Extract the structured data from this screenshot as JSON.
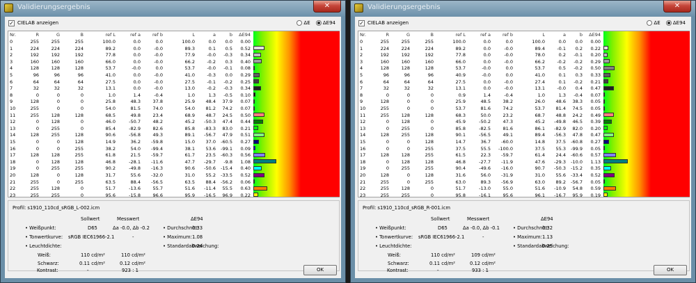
{
  "windows": [
    {
      "title": "Validierungsergebnis",
      "show_cielab_label": "CIELAB anzeigen",
      "radio_de": "ΔE",
      "radio_de94": "ΔE94",
      "headers": [
        "Nr.",
        "R",
        "G",
        "B",
        "ref L",
        "ref a",
        "ref b",
        "L",
        "a",
        "b",
        "ΔE94"
      ],
      "rows": [
        [
          "0",
          "255",
          "255",
          "255",
          "100.0",
          "0.0",
          "0.0",
          "100.0",
          "0.0",
          "0.0",
          "0.00"
        ],
        [
          "1",
          "224",
          "224",
          "224",
          "89.2",
          "0.0",
          "-0.0",
          "89.3",
          "0.1",
          "0.5",
          "0.52"
        ],
        [
          "2",
          "192",
          "192",
          "192",
          "77.8",
          "0.0",
          "-0.0",
          "77.9",
          "-0.0",
          "-0.3",
          "0.34"
        ],
        [
          "3",
          "160",
          "160",
          "160",
          "66.0",
          "0.0",
          "-0.0",
          "66.2",
          "-0.2",
          "0.3",
          "0.40"
        ],
        [
          "4",
          "128",
          "128",
          "128",
          "53.7",
          "-0.0",
          "0.0",
          "53.7",
          "-0.0",
          "-0.1",
          "0.08"
        ],
        [
          "5",
          "96",
          "96",
          "96",
          "41.0",
          "0.0",
          "-0.0",
          "41.0",
          "-0.3",
          "0.0",
          "0.29"
        ],
        [
          "6",
          "64",
          "64",
          "64",
          "27.5",
          "0.0",
          "-0.0",
          "27.5",
          "-0.1",
          "-0.2",
          "0.25"
        ],
        [
          "7",
          "32",
          "32",
          "32",
          "13.1",
          "0.0",
          "-0.0",
          "13.0",
          "-0.2",
          "-0.3",
          "0.34"
        ],
        [
          "8",
          "0",
          "0",
          "0",
          "1.0",
          "1.4",
          "-0.4",
          "1.0",
          "1.3",
          "-0.5",
          "0.10"
        ],
        [
          "9",
          "128",
          "0",
          "0",
          "25.8",
          "48.3",
          "37.8",
          "25.9",
          "48.4",
          "37.9",
          "0.07"
        ],
        [
          "10",
          "255",
          "0",
          "0",
          "54.0",
          "81.5",
          "74.0",
          "54.0",
          "81.2",
          "74.2",
          "0.07"
        ],
        [
          "11",
          "255",
          "128",
          "128",
          "68.5",
          "49.8",
          "23.4",
          "68.9",
          "48.7",
          "24.5",
          "0.50"
        ],
        [
          "12",
          "0",
          "128",
          "0",
          "46.0",
          "-50.7",
          "48.2",
          "45.2",
          "-50.3",
          "47.4",
          "0.44"
        ],
        [
          "13",
          "0",
          "255",
          "0",
          "85.4",
          "-82.9",
          "82.6",
          "85.8",
          "-83.3",
          "83.0",
          "0.21"
        ],
        [
          "14",
          "128",
          "255",
          "128",
          "90.6",
          "-56.8",
          "49.3",
          "89.1",
          "-56.7",
          "47.9",
          "0.51"
        ],
        [
          "15",
          "0",
          "0",
          "128",
          "14.9",
          "36.2",
          "-59.8",
          "15.0",
          "37.0",
          "-60.5",
          "0.27"
        ],
        [
          "16",
          "0",
          "0",
          "255",
          "38.2",
          "54.0",
          "-99.4",
          "38.1",
          "53.6",
          "-99.1",
          "0.09"
        ],
        [
          "17",
          "128",
          "128",
          "255",
          "61.8",
          "21.5",
          "-59.7",
          "61.7",
          "23.5",
          "-60.3",
          "0.56"
        ],
        [
          "18",
          "0",
          "128",
          "128",
          "46.8",
          "-28.1",
          "-11.6",
          "47.7",
          "-29.7",
          "-9.8",
          "1.08"
        ],
        [
          "19",
          "0",
          "255",
          "255",
          "90.2",
          "-49.8",
          "-16.3",
          "90.6",
          "-50.6",
          "-15.4",
          "0.40"
        ],
        [
          "20",
          "128",
          "0",
          "128",
          "31.7",
          "55.6",
          "-32.0",
          "31.0",
          "55.2",
          "-33.5",
          "0.52"
        ],
        [
          "21",
          "255",
          "0",
          "255",
          "63.5",
          "88.4",
          "-56.5",
          "63.5",
          "88.4",
          "-56.2",
          "0.06"
        ],
        [
          "22",
          "255",
          "128",
          "0",
          "51.7",
          "-13.6",
          "55.7",
          "51.6",
          "-11.4",
          "55.5",
          "0.63"
        ],
        [
          "23",
          "255",
          "255",
          "0",
          "95.6",
          "-15.8",
          "96.6",
          "95.9",
          "-16.5",
          "96.9",
          "0.22"
        ]
      ],
      "profile": "Profil:  s1910_110cd_sRGB_L-002.icm",
      "col_soll": "Sollwert",
      "col_mess": "Messwert",
      "col_de": "ΔE94",
      "weisspunkt_label": "• Weißpunkt:",
      "weisspunkt_soll": "D65",
      "weisspunkt_mess": "Δa -0.0, Δb -0.2",
      "tonwert_label": "• Tonwertkurve:",
      "tonwert_soll": "sRGB IEC61966-2.1",
      "tonwert_mess": "-",
      "leucht_label": "• Leuchtdichte:",
      "weiss_label": "Weiß:",
      "weiss_soll": "110 cd/m²",
      "weiss_mess": "110 cd/m²",
      "schwarz_label": "Schwarz:",
      "schwarz_soll": "0.11 cd/m²",
      "schwarz_mess": "0.12 cd/m²",
      "kontrast_label": "Kontrast:",
      "kontrast_soll": "-",
      "kontrast_mess": "923 : 1",
      "durch_label": "• Durchschnitt:",
      "durch_val": "0.33",
      "max_label": "• Maximum:",
      "max_val": "1.08",
      "std_label": "• Standardabweichung:",
      "std_val": "0.24",
      "ok_label": "OK"
    },
    {
      "title": "Validierungsergebnis",
      "show_cielab_label": "CIELAB anzeigen",
      "radio_de": "ΔE",
      "radio_de94": "ΔE94",
      "headers": [
        "Nr.",
        "R",
        "G",
        "B",
        "ref L",
        "ref a",
        "ref b",
        "L",
        "a",
        "b",
        "ΔE94"
      ],
      "rows": [
        [
          "0",
          "255",
          "255",
          "255",
          "100.0",
          "0.0",
          "0.0",
          "100.0",
          "0.0",
          "0.0",
          "0.00"
        ],
        [
          "1",
          "224",
          "224",
          "224",
          "89.2",
          "0.0",
          "-0.0",
          "89.4",
          "-0.1",
          "0.2",
          "0.22"
        ],
        [
          "2",
          "192",
          "192",
          "192",
          "77.8",
          "0.0",
          "-0.0",
          "78.0",
          "0.2",
          "-0.1",
          "0.20"
        ],
        [
          "3",
          "160",
          "160",
          "160",
          "66.0",
          "0.0",
          "-0.0",
          "66.2",
          "-0.2",
          "-0.2",
          "0.29"
        ],
        [
          "4",
          "128",
          "128",
          "128",
          "53.7",
          "-0.0",
          "0.0",
          "53.7",
          "0.5",
          "-0.2",
          "0.50"
        ],
        [
          "5",
          "96",
          "96",
          "96",
          "40.9",
          "-0.0",
          "0.0",
          "41.0",
          "0.1",
          "0.3",
          "0.33"
        ],
        [
          "6",
          "64",
          "64",
          "64",
          "27.5",
          "0.0",
          "-0.0",
          "27.4",
          "0.1",
          "-0.2",
          "0.21"
        ],
        [
          "7",
          "32",
          "32",
          "32",
          "13.1",
          "0.0",
          "-0.0",
          "13.1",
          "-0.0",
          "0.4",
          "0.47"
        ],
        [
          "8",
          "0",
          "0",
          "0",
          "0.9",
          "1.4",
          "-0.4",
          "1.0",
          "1.3",
          "-0.4",
          "0.07"
        ],
        [
          "9",
          "128",
          "0",
          "0",
          "25.9",
          "48.5",
          "38.2",
          "26.0",
          "48.6",
          "38.3",
          "0.05"
        ],
        [
          "10",
          "255",
          "0",
          "0",
          "53.7",
          "81.6",
          "74.2",
          "53.7",
          "81.4",
          "74.5",
          "0.05"
        ],
        [
          "11",
          "255",
          "128",
          "128",
          "68.3",
          "50.0",
          "23.2",
          "68.7",
          "48.8",
          "24.2",
          "0.49"
        ],
        [
          "12",
          "0",
          "128",
          "0",
          "45.9",
          "-50.2",
          "47.3",
          "45.2",
          "-49.8",
          "46.5",
          "0.39"
        ],
        [
          "13",
          "0",
          "255",
          "0",
          "85.8",
          "-82.5",
          "81.6",
          "86.1",
          "-82.9",
          "82.0",
          "0.20"
        ],
        [
          "14",
          "128",
          "255",
          "128",
          "90.1",
          "-56.5",
          "49.1",
          "89.4",
          "-56.3",
          "47.8",
          "0.47"
        ],
        [
          "15",
          "0",
          "0",
          "128",
          "14.7",
          "36.7",
          "-60.0",
          "14.8",
          "37.5",
          "-60.8",
          "0.27"
        ],
        [
          "16",
          "0",
          "0",
          "255",
          "37.5",
          "55.5",
          "-100.0",
          "37.5",
          "55.3",
          "-99.9",
          "0.05"
        ],
        [
          "17",
          "128",
          "128",
          "255",
          "61.5",
          "22.3",
          "-59.7",
          "61.4",
          "24.4",
          "-60.6",
          "0.57"
        ],
        [
          "18",
          "0",
          "128",
          "128",
          "46.8",
          "-27.7",
          "-11.9",
          "47.6",
          "-29.3",
          "-10.0",
          "1.13"
        ],
        [
          "19",
          "0",
          "255",
          "255",
          "90.4",
          "-49.6",
          "-16.0",
          "90.7",
          "-50.3",
          "-15.2",
          "0.35"
        ],
        [
          "20",
          "128",
          "0",
          "128",
          "31.6",
          "56.0",
          "-31.9",
          "31.0",
          "55.6",
          "-33.4",
          "0.52"
        ],
        [
          "21",
          "255",
          "0",
          "255",
          "63.0",
          "89.3",
          "-56.9",
          "63.0",
          "89.2",
          "-56.7",
          "0.05"
        ],
        [
          "22",
          "255",
          "128",
          "0",
          "51.7",
          "-13.0",
          "55.0",
          "51.6",
          "-10.9",
          "54.8",
          "0.59"
        ],
        [
          "23",
          "255",
          "255",
          "0",
          "95.8",
          "-16.1",
          "95.6",
          "96.1",
          "-16.7",
          "95.9",
          "0.19"
        ]
      ],
      "profile": "Profil:  s1910_110cd_sRGB_R-001.icm",
      "col_soll": "Sollwert",
      "col_mess": "Messwert",
      "col_de": "ΔE94",
      "weisspunkt_label": "• Weißpunkt:",
      "weisspunkt_soll": "D65",
      "weisspunkt_mess": "Δa -0.0, Δb -0.1",
      "tonwert_label": "• Tonwertkurve:",
      "tonwert_soll": "sRGB IEC61966-2.1",
      "tonwert_mess": "-",
      "leucht_label": "• Leuchtdichte:",
      "weiss_label": "Weiß:",
      "weiss_soll": "110 cd/m²",
      "weiss_mess": "109 cd/m²",
      "schwarz_label": "Schwarz:",
      "schwarz_soll": "0.11 cd/m²",
      "schwarz_mess": "0.12 cd/m²",
      "kontrast_label": "Kontrast:",
      "kontrast_soll": "-",
      "kontrast_mess": "933 : 1",
      "durch_label": "• Durchschnitt:",
      "durch_val": "0.32",
      "max_label": "• Maximum:",
      "max_val": "1.13",
      "std_label": "• Standardabweichung:",
      "std_val": "0.25",
      "ok_label": "OK"
    }
  ],
  "bar_scale_max": 4.0
}
